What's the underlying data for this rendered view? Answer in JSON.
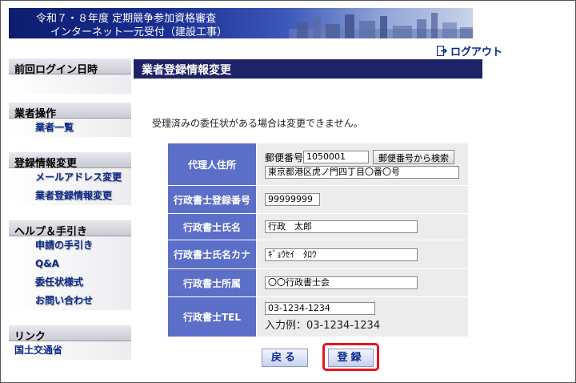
{
  "header": {
    "line1": "令和７・８年度 定期競争参加資格審査",
    "line2": "インターネット一元受付（建設工事）",
    "logout_label": "ログアウト"
  },
  "sidebar": {
    "last_login": {
      "title": "前回ログイン日時"
    },
    "ops": {
      "title": "業者操作",
      "items": [
        "業者一覧"
      ]
    },
    "reg": {
      "title": "登録情報変更",
      "items": [
        "メールアドレス変更",
        "業者登録情報変更"
      ]
    },
    "help": {
      "title": "ヘルプ＆手引き",
      "items": [
        "申請の手引き",
        "Q&A",
        "委任状様式",
        "お問い合わせ"
      ]
    },
    "link": {
      "title": "リンク",
      "items": [
        "国土交通省"
      ]
    }
  },
  "main": {
    "title": "業者登録情報変更",
    "notice": "受理済みの委任状がある場合は変更できません。",
    "form": {
      "address_label": "代理人住所",
      "postal_label": "郵便番号",
      "postal_value": "1050001",
      "postal_search_button": "郵便番号から検索",
      "address_value": "東京都港区虎ノ門四丁目〇番〇号",
      "reg_no_label": "行政書士登録番号",
      "reg_no_value": "99999999",
      "name_label": "行政書士氏名",
      "name_value": "行政　太郎",
      "kana_label": "行政書士氏名カナ",
      "kana_value": "ｷﾞｮｳｾｲ　ﾀﾛｳ",
      "office_label": "行政書士所属",
      "office_value": "〇〇行政書士会",
      "tel_label": "行政書士TEL",
      "tel_value": "03-1234-1234",
      "tel_example": "入力例：03-1234-1234"
    },
    "back_label": "戻る",
    "register_label": "登録"
  },
  "colors": {
    "banner_dark": "#0d1d6e",
    "title_bar": "#1d2366",
    "label_cell": "#5b6ec8",
    "highlight": "#e8141b",
    "link": "#0a2a8a"
  }
}
